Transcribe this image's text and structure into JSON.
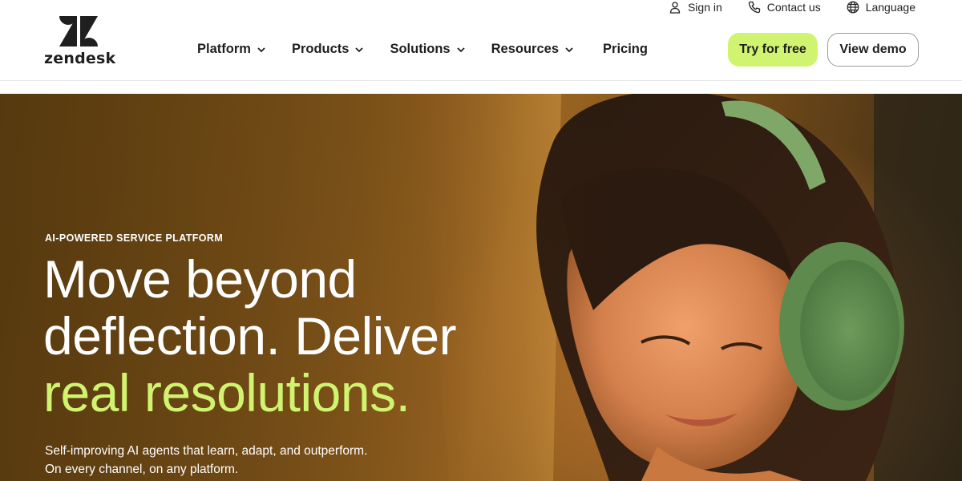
{
  "brand": {
    "name": "zendesk"
  },
  "utility": {
    "sign_in": "Sign in",
    "contact_us": "Contact us",
    "language": "Language"
  },
  "nav": {
    "items": [
      {
        "label": "Platform",
        "has_dropdown": true
      },
      {
        "label": "Products",
        "has_dropdown": true
      },
      {
        "label": "Solutions",
        "has_dropdown": true
      },
      {
        "label": "Resources",
        "has_dropdown": true
      },
      {
        "label": "Pricing",
        "has_dropdown": false
      }
    ]
  },
  "cta": {
    "try_label": "Try for free",
    "demo_label": "View demo"
  },
  "hero": {
    "eyebrow": "AI-POWERED SERVICE PLATFORM",
    "headline_line1": "Move beyond",
    "headline_line2": "deflection. Deliver",
    "headline_accent": "real resolutions.",
    "sub_line1": "Self-improving AI agents that learn, adapt, and outperform.",
    "sub_line2": "On every channel, on any platform."
  },
  "colors": {
    "accent": "#d1f470",
    "text": "#1f1f1f",
    "hero_text": "#ffffff"
  },
  "icons": {
    "sign_in": "user-icon",
    "contact_us": "phone-icon",
    "language": "globe-icon",
    "nav_dropdown": "chevron-down-icon"
  }
}
